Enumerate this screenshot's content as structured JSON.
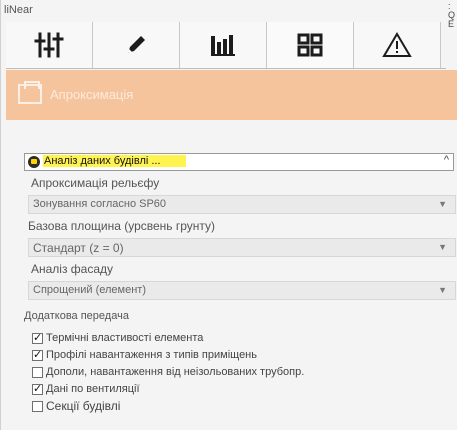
{
  "app": {
    "title": "liNear"
  },
  "corner": {
    "top": ":",
    "middle": "Q",
    "bottom": "E"
  },
  "toolbar": {
    "buttons": [
      {
        "icon": "sliders-icon"
      },
      {
        "icon": "pencil-icon"
      },
      {
        "icon": "bar-chart-icon"
      },
      {
        "icon": "grid-icon"
      },
      {
        "icon": "warning-icon"
      }
    ]
  },
  "header": {
    "title": "Апроксимація"
  },
  "section": {
    "title": "Аналіз даних будівлі ...",
    "caret": "^"
  },
  "fields": {
    "terrain_label": "Апроксимація рельєфу",
    "terrain_value": "Зонування согласно SP60",
    "base_label": "Базова площина (урсвень грунту)",
    "base_value": "Стандарт (z = 0)",
    "facade_label": "Аналіз фасаду",
    "facade_value": "Спрощений (елемент)"
  },
  "additional": {
    "label": "Додаткова передача",
    "items": [
      {
        "label": "Термічні властивості елемента",
        "checked": true
      },
      {
        "label": "Профілі навантаження з типів приміщень",
        "checked": true
      },
      {
        "label": "Дополи, навантаження від неізольованих трубопр.",
        "checked": false
      },
      {
        "label": "Дані по вентиляції",
        "checked": true
      },
      {
        "label": "Секції будівлі",
        "checked": false
      }
    ]
  },
  "colors": {
    "accent": "#f5c49d",
    "highlight": "#fff44f"
  }
}
